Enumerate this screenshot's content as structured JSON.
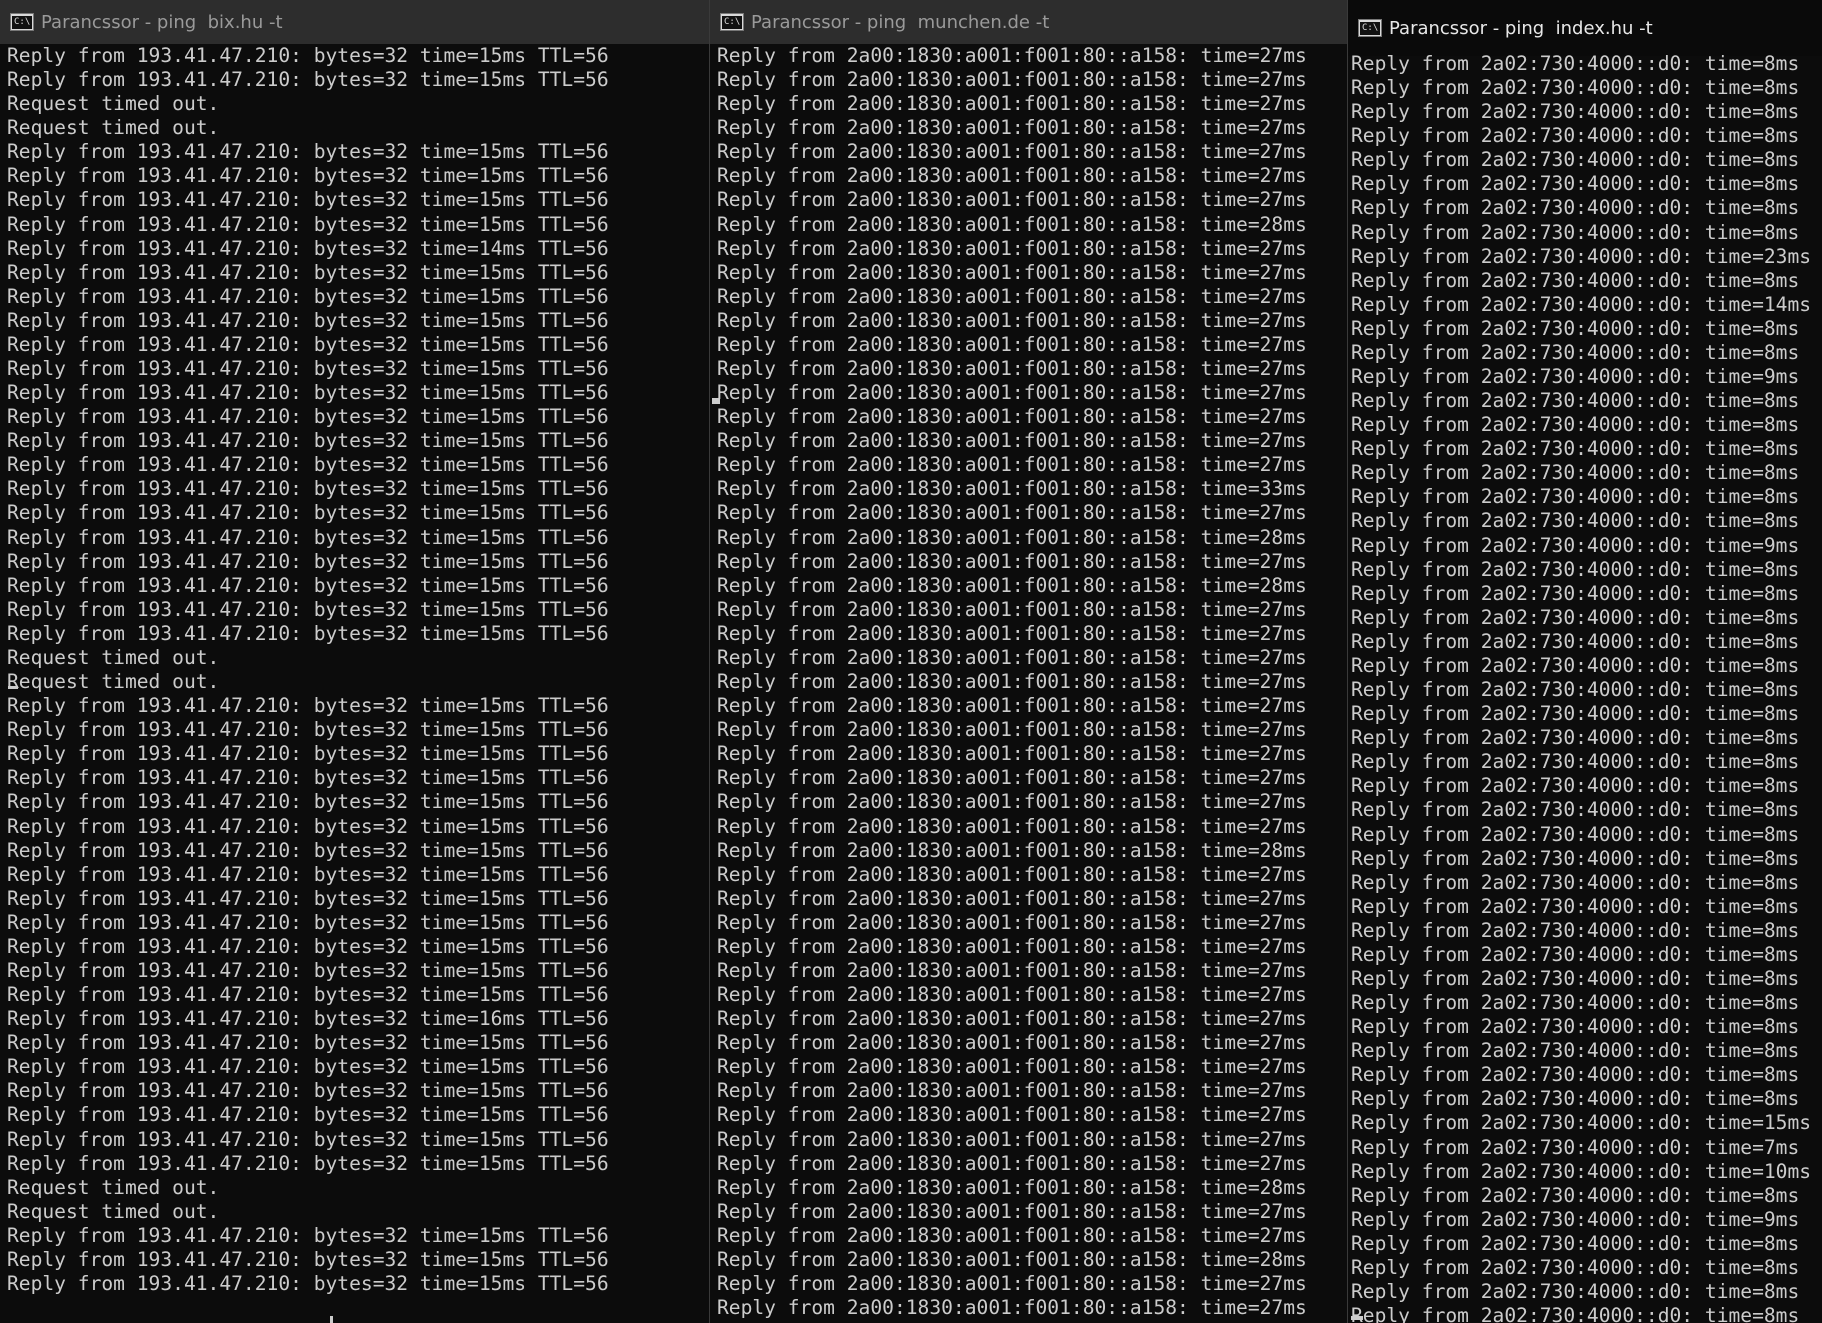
{
  "windows": [
    {
      "title": "Parancssor - ping  bix.hu -t",
      "lines": [
        "Reply from 193.41.47.210: bytes=32 time=15ms TTL=56",
        "Reply from 193.41.47.210: bytes=32 time=15ms TTL=56",
        "Request timed out.",
        "Request timed out.",
        "Reply from 193.41.47.210: bytes=32 time=15ms TTL=56",
        "Reply from 193.41.47.210: bytes=32 time=15ms TTL=56",
        "Reply from 193.41.47.210: bytes=32 time=15ms TTL=56",
        "Reply from 193.41.47.210: bytes=32 time=15ms TTL=56",
        "Reply from 193.41.47.210: bytes=32 time=14ms TTL=56",
        "Reply from 193.41.47.210: bytes=32 time=15ms TTL=56",
        "Reply from 193.41.47.210: bytes=32 time=15ms TTL=56",
        "Reply from 193.41.47.210: bytes=32 time=15ms TTL=56",
        "Reply from 193.41.47.210: bytes=32 time=15ms TTL=56",
        "Reply from 193.41.47.210: bytes=32 time=15ms TTL=56",
        "Reply from 193.41.47.210: bytes=32 time=15ms TTL=56",
        "Reply from 193.41.47.210: bytes=32 time=15ms TTL=56",
        "Reply from 193.41.47.210: bytes=32 time=15ms TTL=56",
        "Reply from 193.41.47.210: bytes=32 time=15ms TTL=56",
        "Reply from 193.41.47.210: bytes=32 time=15ms TTL=56",
        "Reply from 193.41.47.210: bytes=32 time=15ms TTL=56",
        "Reply from 193.41.47.210: bytes=32 time=15ms TTL=56",
        "Reply from 193.41.47.210: bytes=32 time=15ms TTL=56",
        "Reply from 193.41.47.210: bytes=32 time=15ms TTL=56",
        "Reply from 193.41.47.210: bytes=32 time=15ms TTL=56",
        "Reply from 193.41.47.210: bytes=32 time=15ms TTL=56",
        "Request timed out.",
        "Request timed out.",
        "Reply from 193.41.47.210: bytes=32 time=15ms TTL=56",
        "Reply from 193.41.47.210: bytes=32 time=15ms TTL=56",
        "Reply from 193.41.47.210: bytes=32 time=15ms TTL=56",
        "Reply from 193.41.47.210: bytes=32 time=15ms TTL=56",
        "Reply from 193.41.47.210: bytes=32 time=15ms TTL=56",
        "Reply from 193.41.47.210: bytes=32 time=15ms TTL=56",
        "Reply from 193.41.47.210: bytes=32 time=15ms TTL=56",
        "Reply from 193.41.47.210: bytes=32 time=15ms TTL=56",
        "Reply from 193.41.47.210: bytes=32 time=15ms TTL=56",
        "Reply from 193.41.47.210: bytes=32 time=15ms TTL=56",
        "Reply from 193.41.47.210: bytes=32 time=15ms TTL=56",
        "Reply from 193.41.47.210: bytes=32 time=15ms TTL=56",
        "Reply from 193.41.47.210: bytes=32 time=15ms TTL=56",
        "Reply from 193.41.47.210: bytes=32 time=16ms TTL=56",
        "Reply from 193.41.47.210: bytes=32 time=15ms TTL=56",
        "Reply from 193.41.47.210: bytes=32 time=15ms TTL=56",
        "Reply from 193.41.47.210: bytes=32 time=15ms TTL=56",
        "Reply from 193.41.47.210: bytes=32 time=15ms TTL=56",
        "Reply from 193.41.47.210: bytes=32 time=15ms TTL=56",
        "Reply from 193.41.47.210: bytes=32 time=15ms TTL=56",
        "Request timed out.",
        "Request timed out.",
        "Reply from 193.41.47.210: bytes=32 time=15ms TTL=56",
        "Reply from 193.41.47.210: bytes=32 time=15ms TTL=56",
        "Reply from 193.41.47.210: bytes=32 time=15ms TTL=56"
      ]
    },
    {
      "title": "Parancssor - ping  munchen.de -t",
      "lines": [
        "Reply from 2a00:1830:a001:f001:80::a158: time=27ms",
        "Reply from 2a00:1830:a001:f001:80::a158: time=27ms",
        "Reply from 2a00:1830:a001:f001:80::a158: time=27ms",
        "Reply from 2a00:1830:a001:f001:80::a158: time=27ms",
        "Reply from 2a00:1830:a001:f001:80::a158: time=27ms",
        "Reply from 2a00:1830:a001:f001:80::a158: time=27ms",
        "Reply from 2a00:1830:a001:f001:80::a158: time=27ms",
        "Reply from 2a00:1830:a001:f001:80::a158: time=28ms",
        "Reply from 2a00:1830:a001:f001:80::a158: time=27ms",
        "Reply from 2a00:1830:a001:f001:80::a158: time=27ms",
        "Reply from 2a00:1830:a001:f001:80::a158: time=27ms",
        "Reply from 2a00:1830:a001:f001:80::a158: time=27ms",
        "Reply from 2a00:1830:a001:f001:80::a158: time=27ms",
        "Reply from 2a00:1830:a001:f001:80::a158: time=27ms",
        "Reply from 2a00:1830:a001:f001:80::a158: time=27ms",
        "Reply from 2a00:1830:a001:f001:80::a158: time=27ms",
        "Reply from 2a00:1830:a001:f001:80::a158: time=27ms",
        "Reply from 2a00:1830:a001:f001:80::a158: time=27ms",
        "Reply from 2a00:1830:a001:f001:80::a158: time=33ms",
        "Reply from 2a00:1830:a001:f001:80::a158: time=27ms",
        "Reply from 2a00:1830:a001:f001:80::a158: time=28ms",
        "Reply from 2a00:1830:a001:f001:80::a158: time=27ms",
        "Reply from 2a00:1830:a001:f001:80::a158: time=28ms",
        "Reply from 2a00:1830:a001:f001:80::a158: time=27ms",
        "Reply from 2a00:1830:a001:f001:80::a158: time=27ms",
        "Reply from 2a00:1830:a001:f001:80::a158: time=27ms",
        "Reply from 2a00:1830:a001:f001:80::a158: time=27ms",
        "Reply from 2a00:1830:a001:f001:80::a158: time=27ms",
        "Reply from 2a00:1830:a001:f001:80::a158: time=27ms",
        "Reply from 2a00:1830:a001:f001:80::a158: time=27ms",
        "Reply from 2a00:1830:a001:f001:80::a158: time=27ms",
        "Reply from 2a00:1830:a001:f001:80::a158: time=27ms",
        "Reply from 2a00:1830:a001:f001:80::a158: time=27ms",
        "Reply from 2a00:1830:a001:f001:80::a158: time=28ms",
        "Reply from 2a00:1830:a001:f001:80::a158: time=27ms",
        "Reply from 2a00:1830:a001:f001:80::a158: time=27ms",
        "Reply from 2a00:1830:a001:f001:80::a158: time=27ms",
        "Reply from 2a00:1830:a001:f001:80::a158: time=27ms",
        "Reply from 2a00:1830:a001:f001:80::a158: time=27ms",
        "Reply from 2a00:1830:a001:f001:80::a158: time=27ms",
        "Reply from 2a00:1830:a001:f001:80::a158: time=27ms",
        "Reply from 2a00:1830:a001:f001:80::a158: time=27ms",
        "Reply from 2a00:1830:a001:f001:80::a158: time=27ms",
        "Reply from 2a00:1830:a001:f001:80::a158: time=27ms",
        "Reply from 2a00:1830:a001:f001:80::a158: time=27ms",
        "Reply from 2a00:1830:a001:f001:80::a158: time=27ms",
        "Reply from 2a00:1830:a001:f001:80::a158: time=27ms",
        "Reply from 2a00:1830:a001:f001:80::a158: time=28ms",
        "Reply from 2a00:1830:a001:f001:80::a158: time=27ms",
        "Reply from 2a00:1830:a001:f001:80::a158: time=27ms",
        "Reply from 2a00:1830:a001:f001:80::a158: time=28ms",
        "Reply from 2a00:1830:a001:f001:80::a158: time=27ms",
        "Reply from 2a00:1830:a001:f001:80::a158: time=27ms"
      ]
    },
    {
      "title": "Parancssor - ping  index.hu -t",
      "lines": [
        "Reply from 2a02:730:4000::d0: time=8ms",
        "Reply from 2a02:730:4000::d0: time=8ms",
        "Reply from 2a02:730:4000::d0: time=8ms",
        "Reply from 2a02:730:4000::d0: time=8ms",
        "Reply from 2a02:730:4000::d0: time=8ms",
        "Reply from 2a02:730:4000::d0: time=8ms",
        "Reply from 2a02:730:4000::d0: time=8ms",
        "Reply from 2a02:730:4000::d0: time=8ms",
        "Reply from 2a02:730:4000::d0: time=23ms",
        "Reply from 2a02:730:4000::d0: time=8ms",
        "Reply from 2a02:730:4000::d0: time=14ms",
        "Reply from 2a02:730:4000::d0: time=8ms",
        "Reply from 2a02:730:4000::d0: time=8ms",
        "Reply from 2a02:730:4000::d0: time=9ms",
        "Reply from 2a02:730:4000::d0: time=8ms",
        "Reply from 2a02:730:4000::d0: time=8ms",
        "Reply from 2a02:730:4000::d0: time=8ms",
        "Reply from 2a02:730:4000::d0: time=8ms",
        "Reply from 2a02:730:4000::d0: time=8ms",
        "Reply from 2a02:730:4000::d0: time=8ms",
        "Reply from 2a02:730:4000::d0: time=9ms",
        "Reply from 2a02:730:4000::d0: time=8ms",
        "Reply from 2a02:730:4000::d0: time=8ms",
        "Reply from 2a02:730:4000::d0: time=8ms",
        "Reply from 2a02:730:4000::d0: time=8ms",
        "Reply from 2a02:730:4000::d0: time=8ms",
        "Reply from 2a02:730:4000::d0: time=8ms",
        "Reply from 2a02:730:4000::d0: time=8ms",
        "Reply from 2a02:730:4000::d0: time=8ms",
        "Reply from 2a02:730:4000::d0: time=8ms",
        "Reply from 2a02:730:4000::d0: time=8ms",
        "Reply from 2a02:730:4000::d0: time=8ms",
        "Reply from 2a02:730:4000::d0: time=8ms",
        "Reply from 2a02:730:4000::d0: time=8ms",
        "Reply from 2a02:730:4000::d0: time=8ms",
        "Reply from 2a02:730:4000::d0: time=8ms",
        "Reply from 2a02:730:4000::d0: time=8ms",
        "Reply from 2a02:730:4000::d0: time=8ms",
        "Reply from 2a02:730:4000::d0: time=8ms",
        "Reply from 2a02:730:4000::d0: time=8ms",
        "Reply from 2a02:730:4000::d0: time=8ms",
        "Reply from 2a02:730:4000::d0: time=8ms",
        "Reply from 2a02:730:4000::d0: time=8ms",
        "Reply from 2a02:730:4000::d0: time=8ms",
        "Reply from 2a02:730:4000::d0: time=15ms",
        "Reply from 2a02:730:4000::d0: time=7ms",
        "Reply from 2a02:730:4000::d0: time=10ms",
        "Reply from 2a02:730:4000::d0: time=8ms",
        "Reply from 2a02:730:4000::d0: time=9ms",
        "Reply from 2a02:730:4000::d0: time=8ms",
        "Reply from 2a02:730:4000::d0: time=8ms",
        "Reply from 2a02:730:4000::d0: time=8ms",
        "Reply from 2a02:730:4000::d0: time=8ms"
      ]
    }
  ]
}
